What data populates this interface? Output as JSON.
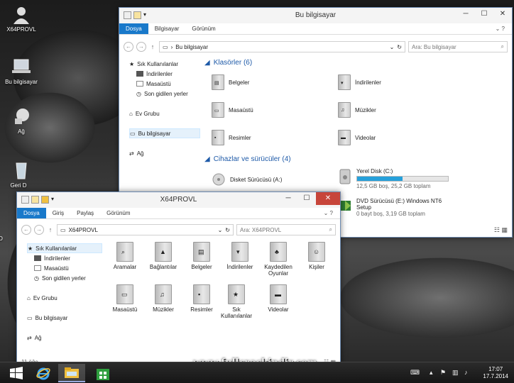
{
  "desktop": {
    "icons": [
      {
        "label": "X64PROVL",
        "icon": "user-icon"
      },
      {
        "label": "Bu bilgisayar",
        "icon": "laptop-icon"
      },
      {
        "label": "Ağ",
        "icon": "network-icon"
      },
      {
        "label": "Geri D",
        "icon": "recycle-bin-icon"
      },
      {
        "label": "D",
        "icon": "file-icon"
      }
    ]
  },
  "back_window": {
    "title": "Bu bilgisayar",
    "tabs": [
      "Dosya",
      "Bilgisayar",
      "Görünüm"
    ],
    "path_prefix": "›",
    "path": "Bu bilgisayar",
    "search_placeholder": "Ara: Bu bilgisayar",
    "nav": {
      "quick_access": "Sık Kullanılanlar",
      "quick_items": [
        "İndirilenler",
        "Masaüstü",
        "Son gidilen yerler"
      ],
      "homegroup": "Ev Grubu",
      "this_pc": "Bu bilgisayar",
      "network": "Ağ"
    },
    "folders_header": "Klasörler (6)",
    "folders_left": [
      "Belgeler",
      "Masaüstü",
      "Resimler"
    ],
    "folders_right": [
      "İndirilenler",
      "Müzikler",
      "Videolar"
    ],
    "devices_header": "Cihazlar ve sürücüler (4)",
    "floppy": "Disket Sürücüsü (A:)",
    "disk_c": {
      "name": "Yerel Disk (C:)",
      "info": "12,5 GB boş, 25,2 GB toplam",
      "used_fraction": 0.5
    },
    "dvd": {
      "name": "DVD Sürücüsü (E:) Windows NT6 Setup",
      "info": "0 bayt boş, 3,19 GB toplam"
    }
  },
  "front_window": {
    "title": "X64PROVL",
    "tabs": [
      "Dosya",
      "Giriş",
      "Paylaş",
      "Görünüm"
    ],
    "path": "X64PROVL",
    "search_placeholder": "Ara: X64PROVL",
    "nav": {
      "quick_access": "Sık Kullanılanlar",
      "quick_items": [
        "İndirilenler",
        "Masaüstü",
        "Son gidilen yerler"
      ],
      "homegroup": "Ev Grubu",
      "this_pc": "Bu bilgisayar",
      "network": "Ağ"
    },
    "items_row1": [
      "Aramalar",
      "Bağlantılar",
      "Belgeler",
      "İndirilenler",
      "Kaydedilen Oyunlar",
      "Kişiler"
    ],
    "items_row2": [
      "Masaüstü",
      "Müzikler",
      "Resimler",
      "Sık Kullanılanlar",
      "Videolar"
    ],
    "status": "11 öğe"
  },
  "taskbar": {
    "clock_time": "17:07",
    "clock_date": "17.7.2014"
  },
  "watermark": "www.fullcrackindir.com",
  "colors": {
    "accent": "#1979ca",
    "close": "#c7453a",
    "section": "#1e5aa8"
  }
}
